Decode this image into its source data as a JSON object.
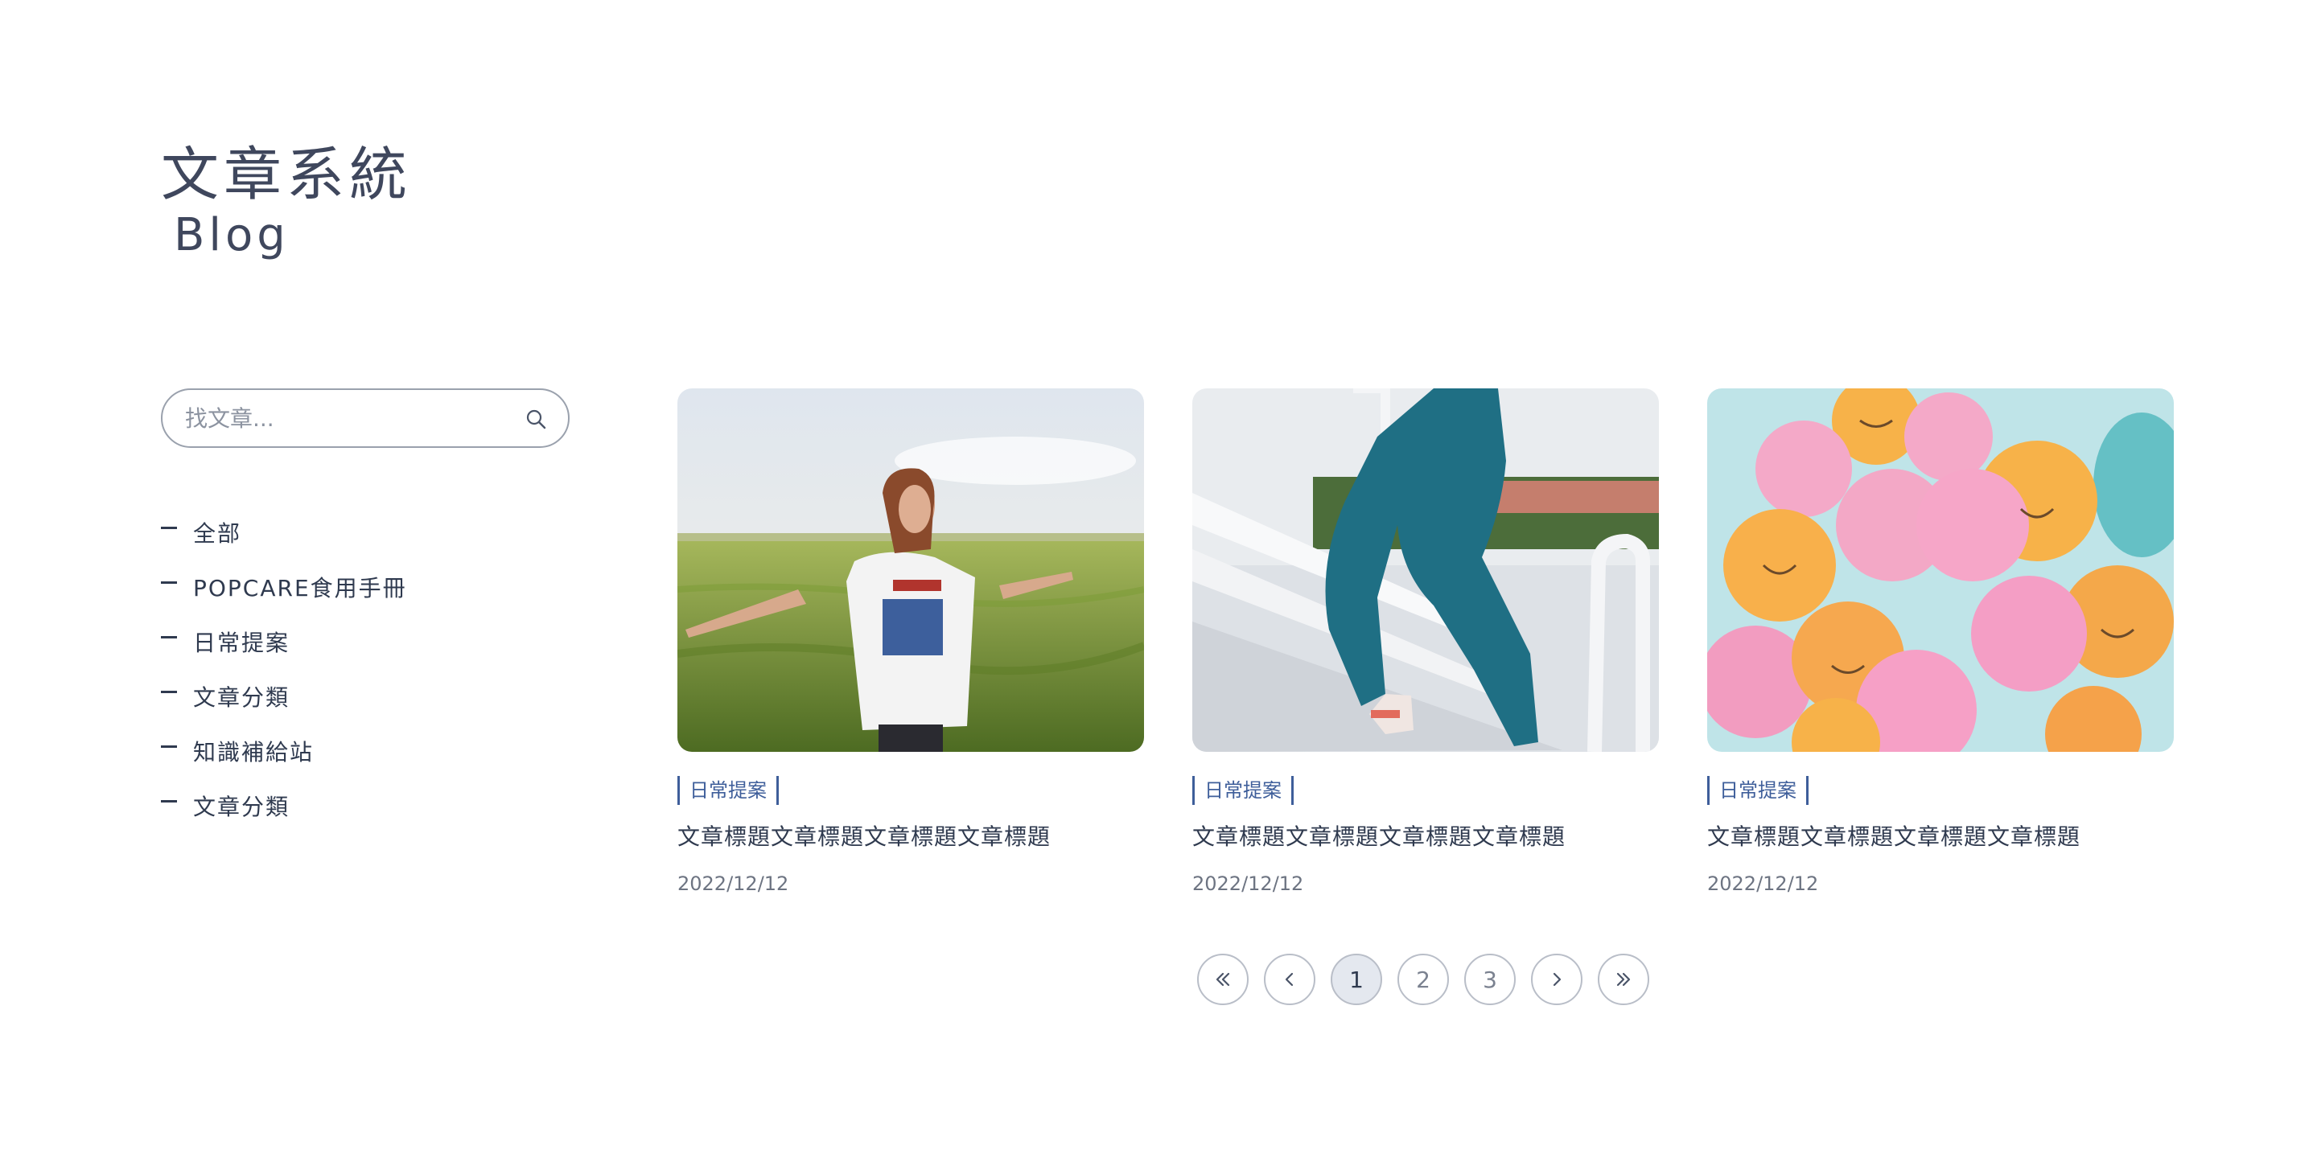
{
  "header": {
    "title_zh": "文章系統",
    "title_en": "Blog"
  },
  "search": {
    "placeholder": "找文章...",
    "icon": "search-icon"
  },
  "categories": [
    {
      "label": "全部"
    },
    {
      "label": "POPCARE食用手冊"
    },
    {
      "label": "日常提案"
    },
    {
      "label": "文章分類"
    },
    {
      "label": "知識補給站"
    },
    {
      "label": "文章分類"
    }
  ],
  "posts": [
    {
      "tag": "日常提案",
      "title": "文章標題文章標題文章標題文章標題",
      "date": "2022/12/12",
      "image": "woman-in-field"
    },
    {
      "tag": "日常提案",
      "title": "文章標題文章標題文章標題文章標題",
      "date": "2022/12/12",
      "image": "legs-on-stairs"
    },
    {
      "tag": "日常提案",
      "title": "文章標題文章標題文章標題文章標題",
      "date": "2022/12/12",
      "image": "smiley-balloons"
    }
  ],
  "pagination": {
    "first_icon": "double-chevron-left-icon",
    "prev_icon": "chevron-left-icon",
    "pages": [
      "1",
      "2",
      "3"
    ],
    "current": "1",
    "next_icon": "chevron-right-icon",
    "last_icon": "double-chevron-right-icon"
  },
  "colors": {
    "accent": "#3e5e9a",
    "text": "#2f3a4f",
    "muted": "#6d7482",
    "active_page_bg": "#e4e8ef"
  }
}
